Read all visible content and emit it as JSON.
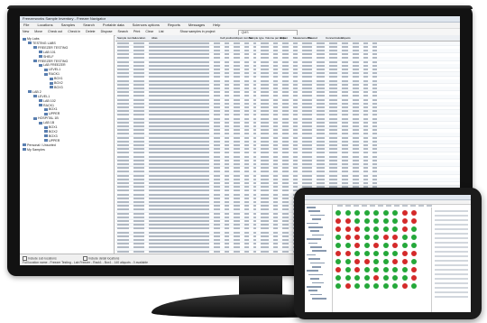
{
  "window": {
    "title": "Freezerworks Sample Inventory - Freezer Navigator"
  },
  "menu": [
    "File",
    "Locations",
    "Samples",
    "Search",
    "Portable data",
    "Sciences options",
    "Reports",
    "Messages",
    "Help"
  ],
  "toolbar": {
    "items": [
      "New",
      "Move",
      "Check out",
      "Check in",
      "Delete",
      "Dispose",
      "Search",
      "Print",
      "Clear",
      "List"
    ],
    "search_label": "Show samples in project",
    "search_value": "QMS"
  },
  "tree": [
    {
      "label": "My Labs",
      "depth": 0
    },
    {
      "label": "TESTING LABS",
      "depth": 1
    },
    {
      "label": "FREEZER TESTING",
      "depth": 2
    },
    {
      "label": "LAB 101",
      "depth": 3
    },
    {
      "label": "SHELF",
      "depth": 3
    },
    {
      "label": "FREEZER TESTING",
      "depth": 2
    },
    {
      "label": "LAB FREEZER",
      "depth": 3
    },
    {
      "label": "LEVEL1",
      "depth": 4
    },
    {
      "label": "RACK1",
      "depth": 4
    },
    {
      "label": "BOX1",
      "depth": 5
    },
    {
      "label": "BOX2",
      "depth": 5
    },
    {
      "label": "BOX3",
      "depth": 5
    },
    {
      "label": "LAB 2",
      "depth": 1
    },
    {
      "label": "LEVEL1",
      "depth": 2
    },
    {
      "label": "LAB 102",
      "depth": 3
    },
    {
      "label": "RACK1",
      "depth": 3
    },
    {
      "label": "BOX1",
      "depth": 4
    },
    {
      "label": "UPPER",
      "depth": 4
    },
    {
      "label": "HOSPITAL 1B",
      "depth": 2
    },
    {
      "label": "LAB 1B",
      "depth": 3
    },
    {
      "label": "BOX1",
      "depth": 4
    },
    {
      "label": "BOX2",
      "depth": 4
    },
    {
      "label": "BOX3",
      "depth": 4
    },
    {
      "label": "UPPER",
      "depth": 4
    },
    {
      "label": "Personal / Unsorted",
      "depth": 0
    },
    {
      "label": "My Samples",
      "depth": 0
    }
  ],
  "grid": {
    "headers": [
      "Sample number",
      "Location",
      "Alias",
      "Cell position",
      "Aliquot number",
      "Sample type",
      "Volume per aliquot",
      "Units",
      "Measurements",
      "Thawed",
      "Concentration",
      "Aliquots"
    ],
    "row_count": 56
  },
  "status": {
    "include_sub": "Include sub locations",
    "include_detail": "Include detail locations",
    "line": "Full location name - Freezer Testing - Lab Freezer - Rack1 - Box1 - 140 aliquots - 0 available"
  },
  "tablet": {
    "plate_states": [
      "gggggggrr",
      "rrgggggrr",
      "rrrggggrg",
      "grrggrrgg",
      "ggrgrgrgg",
      "rrgggggrr",
      "ggrrggrrg",
      "rgrgggggr",
      "ggggrgggr",
      "grgggggrg"
    ],
    "well_colors": {
      "g": "#25a83a",
      "r": "#d42a2a"
    }
  }
}
